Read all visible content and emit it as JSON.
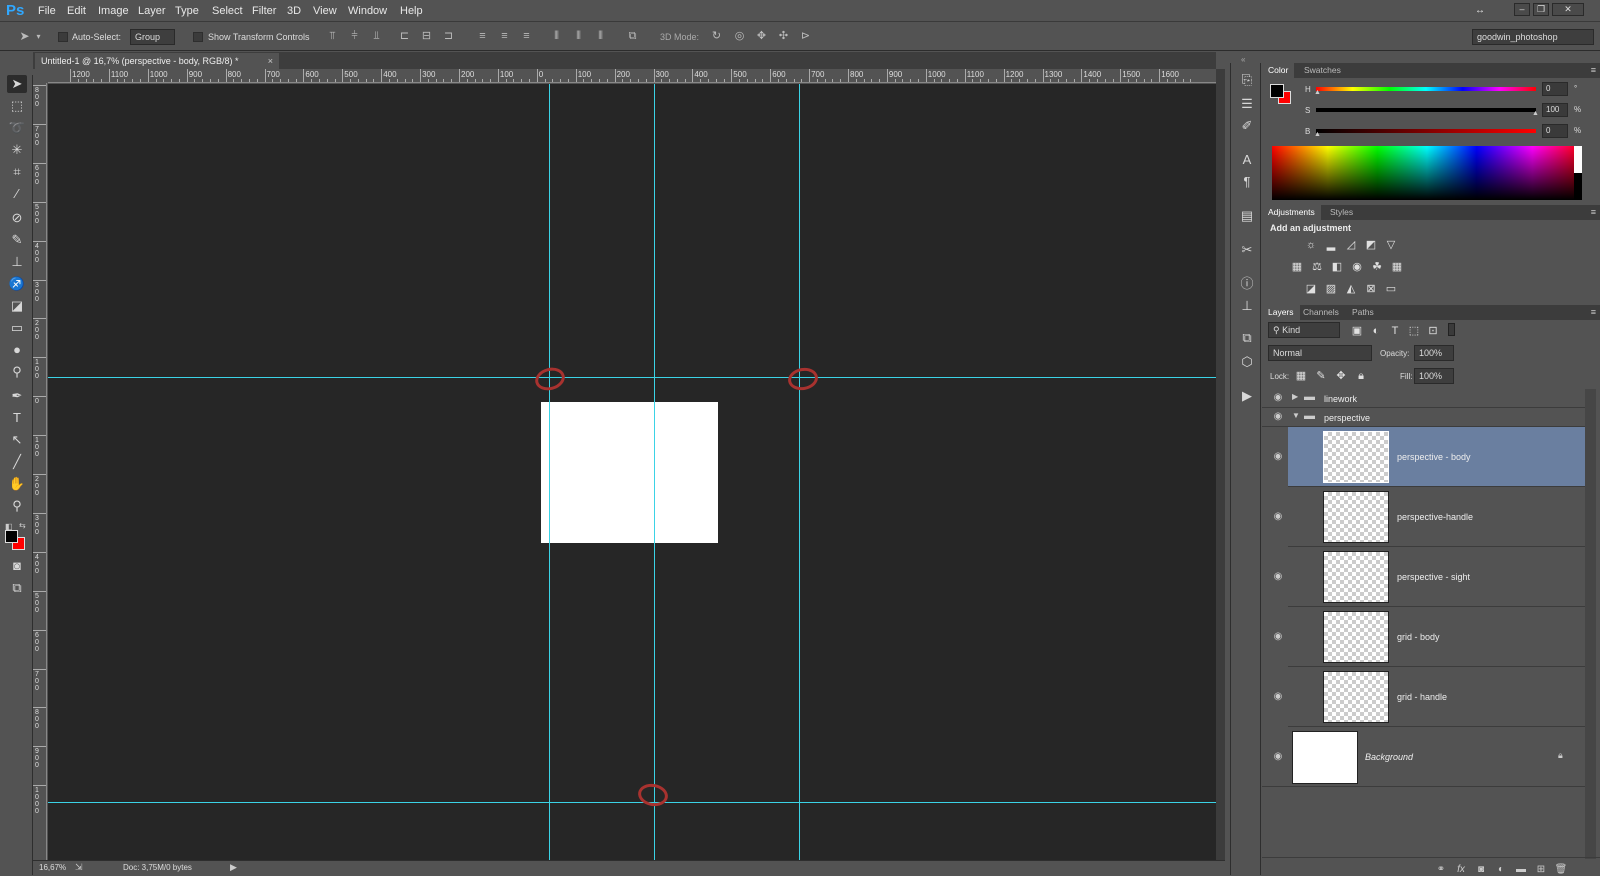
{
  "app": {
    "logo": "Ps"
  },
  "menu": [
    "File",
    "Edit",
    "Image",
    "Layer",
    "Type",
    "Select",
    "Filter",
    "3D",
    "View",
    "Window",
    "Help"
  ],
  "options": {
    "auto_select_label": "Auto-Select:",
    "auto_select_value": "Group",
    "show_transform_label": "Show Transform Controls",
    "mode_3d_label": "3D Mode:",
    "workspace": "goodwin_photoshop"
  },
  "document": {
    "tab_title": "Untitled-1 @ 16,7% (perspective - body, RGB/8) *",
    "zoom": "16,67%",
    "doc_info": "Doc: 3,75M/0 bytes"
  },
  "ruler": {
    "h_labels": [
      "1200",
      "1100",
      "1000",
      "900",
      "800",
      "700",
      "600",
      "500",
      "400",
      "300",
      "200",
      "100",
      "0",
      "100",
      "200",
      "300",
      "400",
      "500",
      "600",
      "700",
      "800",
      "900",
      "1000",
      "1100",
      "1200",
      "1300",
      "1400",
      "1500",
      "1600"
    ],
    "v_labels": [
      "800",
      "700",
      "600",
      "500",
      "400",
      "300",
      "200",
      "100",
      "0",
      "100",
      "200",
      "300",
      "400",
      "500",
      "600",
      "700",
      "800",
      "900",
      "1000"
    ]
  },
  "color_panel": {
    "tabs": [
      "Color",
      "Swatches"
    ],
    "h_label": "H",
    "h_value": "0",
    "h_unit": "°",
    "s_label": "S",
    "s_value": "100",
    "s_unit": "%",
    "b_label": "B",
    "b_value": "0",
    "b_unit": "%",
    "foreground": "#000000",
    "background": "#ff0000"
  },
  "adjustments_panel": {
    "tabs": [
      "Adjustments",
      "Styles"
    ],
    "heading": "Add an adjustment"
  },
  "layers_panel": {
    "tabs": [
      "Layers",
      "Channels",
      "Paths"
    ],
    "kind_label": "Kind",
    "blend_mode": "Normal",
    "opacity_label": "Opacity:",
    "opacity_value": "100%",
    "lock_label": "Lock:",
    "fill_label": "Fill:",
    "fill_value": "100%",
    "groups": [
      "linework",
      "perspective"
    ],
    "layers": [
      {
        "name": "perspective - body",
        "selected": true
      },
      {
        "name": "perspective-handle",
        "selected": false
      },
      {
        "name": "perspective - sight",
        "selected": false
      },
      {
        "name": "grid - body",
        "selected": false
      },
      {
        "name": "grid - handle",
        "selected": false
      }
    ],
    "background_layer": "Background"
  },
  "colors": {
    "guide": "#3bd3e6",
    "canvas_bg": "#262626",
    "annotation": "#a8322f",
    "selection": "#6a7fa0"
  }
}
